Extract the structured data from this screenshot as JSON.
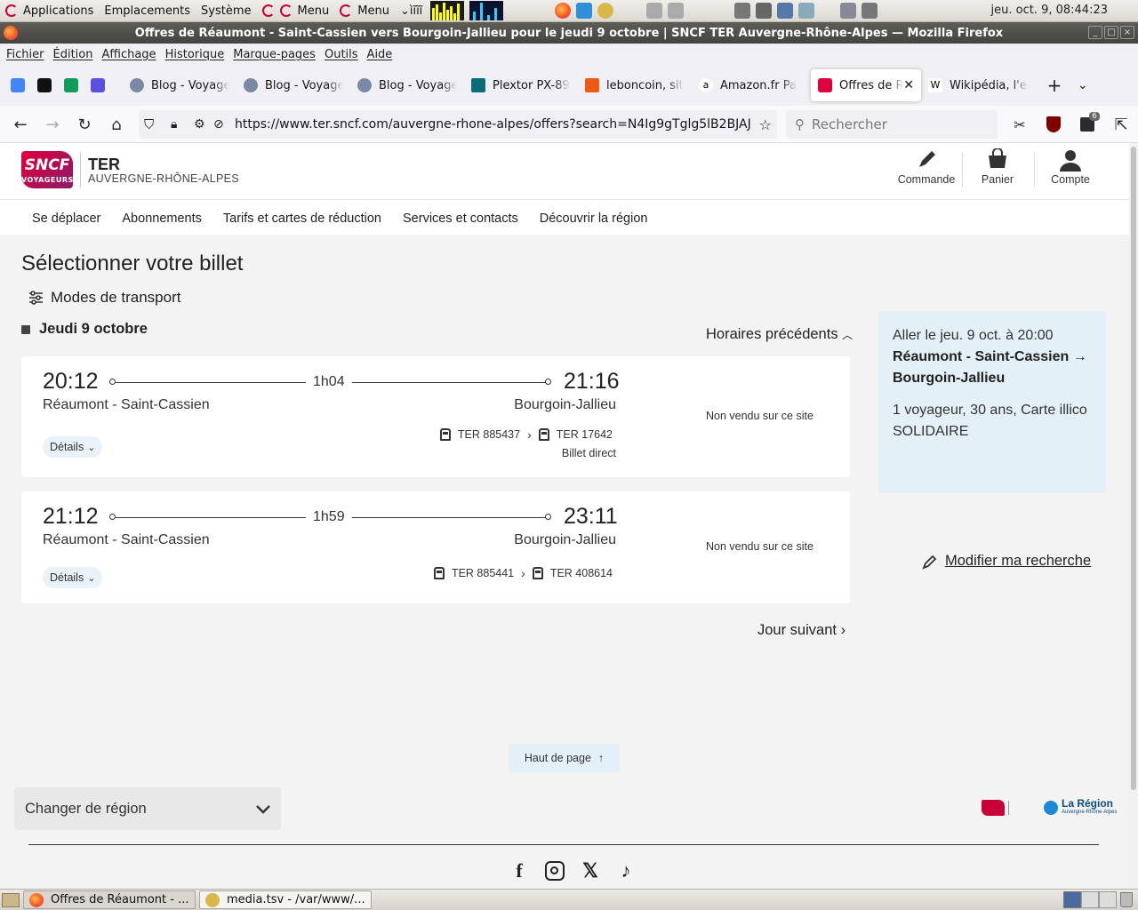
{
  "desktop_panel": {
    "menus": [
      "Applications",
      "Emplacements",
      "Système"
    ],
    "menu_buttons": [
      "Menu",
      "Menu"
    ],
    "kbd_label": "ìĩĩĩ",
    "clock": "jeu. oct. 9, 08:44:23"
  },
  "window": {
    "title": "Offres de Réaumont - Saint-Cassien vers Bourgoin-Jallieu pour le jeudi 9 octobre | SNCF TER Auvergne-Rhône-Alpes — Mozilla Firefox"
  },
  "menubar": [
    "Fichier",
    "Édition",
    "Affichage",
    "Historique",
    "Marque-pages",
    "Outils",
    "Aide"
  ],
  "tabs": [
    {
      "label": "Blog - Voyage"
    },
    {
      "label": "Blog - Voyage"
    },
    {
      "label": "Blog - Voyage"
    },
    {
      "label": "Plextor PX-89"
    },
    {
      "label": "leboncoin, sit"
    },
    {
      "label": "Amazon.fr Pa"
    },
    {
      "label": "Offres de Ré"
    },
    {
      "label": "Wikipédia, l'er"
    }
  ],
  "navbar": {
    "url": "https://www.ter.sncf.com/auvergne-rhone-alpes/offers?search=N4Ig9gTglg5lB2BJAJ",
    "search_placeholder": "Rechercher",
    "extensions_badge": "6"
  },
  "site": {
    "logo_text": "SNCF",
    "logo_sub": "VOYAGEURS",
    "brand": "TER",
    "region": "AUVERGNE-RHÔNE-ALPES",
    "actions": {
      "order": "Commande",
      "cart": "Panier",
      "account": "Compte"
    },
    "nav": [
      "Se déplacer",
      "Abonnements",
      "Tarifs et cartes de réduction",
      "Services et contacts",
      "Découvrir la région"
    ]
  },
  "results": {
    "title": "Sélectionner votre billet",
    "modes": "Modes de transport",
    "day": "Jeudi 9 octobre",
    "previous": "Horaires précédents",
    "next_day": "Jour suivant",
    "details_label": "Détails",
    "not_sold": "Non vendu sur ce site",
    "journeys": [
      {
        "dep_time": "20:12",
        "arr_time": "21:16",
        "duration": "1h04",
        "origin": "Réaumont - Saint-Cassien",
        "destination": "Bourgoin-Jallieu",
        "trains": [
          "TER 885437",
          "TER 17642"
        ],
        "note": "Billet direct"
      },
      {
        "dep_time": "21:12",
        "arr_time": "23:11",
        "duration": "1h59",
        "origin": "Réaumont - Saint-Cassien",
        "destination": "Bourgoin-Jallieu",
        "trains": [
          "TER 885441",
          "TER 408614"
        ],
        "note": ""
      }
    ]
  },
  "summary": {
    "line1": "Aller le jeu. 9 oct. à 20:00",
    "route": "Réaumont - Saint-Cassien → Bourgoin-Jallieu",
    "passenger": "1 voyageur, 30 ans, Carte illico SOLIDAIRE",
    "modify": "Modifier ma recherche"
  },
  "top_button": "Haut de page",
  "footer": {
    "region_select": "Changer de région",
    "la_region": "La Région",
    "la_region_sub": "Auvergne-Rhône-Alpes"
  },
  "taskbar": [
    "Offres de Réaumont - ...",
    "media.tsv - /var/www/..."
  ],
  "colors": {
    "brand_red": "#e0003c",
    "summary_bg": "#e3f0f8",
    "page_bg": "#f3f3f3"
  }
}
